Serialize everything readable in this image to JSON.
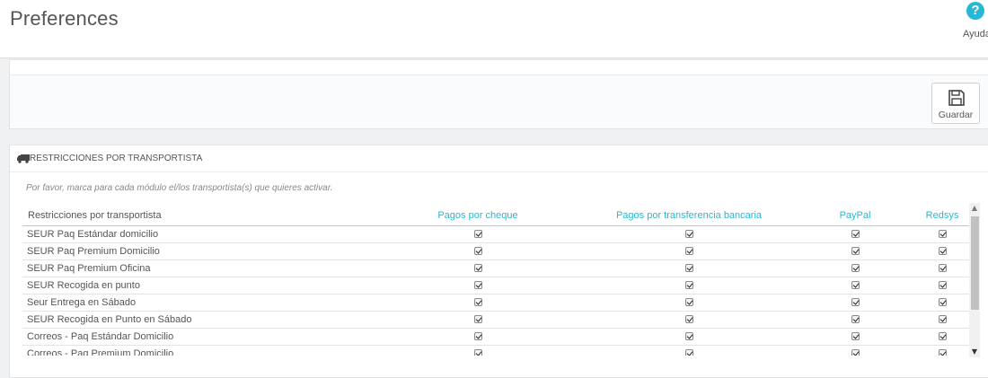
{
  "header": {
    "title": "Preferences",
    "help_icon": "?",
    "help_label": "Ayuda"
  },
  "toolbar": {
    "save_label": "Guardar",
    "save_icon": "floppy-disk-icon"
  },
  "panel": {
    "icon": "truck-icon",
    "heading": "Restricciones por transportista",
    "help_text": "Por favor, marca para cada módulo el/los transportista(s) que quieres activar."
  },
  "table": {
    "columns": [
      "Restricciones por transportista",
      "Pagos por cheque",
      "Pagos por transferencia bancaria",
      "PayPal",
      "Redsys"
    ],
    "rows": [
      {
        "carrier": "SEUR Paq Estándar domicilio",
        "checks": [
          true,
          true,
          true,
          true
        ]
      },
      {
        "carrier": "SEUR Paq Premium Domicilio",
        "checks": [
          true,
          true,
          true,
          true
        ]
      },
      {
        "carrier": "SEUR Paq Premium Oficina",
        "checks": [
          true,
          true,
          true,
          true
        ]
      },
      {
        "carrier": "SEUR Recogida en punto",
        "checks": [
          true,
          true,
          true,
          true
        ]
      },
      {
        "carrier": "Seur Entrega en Sábado",
        "checks": [
          true,
          true,
          true,
          true
        ]
      },
      {
        "carrier": "SEUR Recogida en Punto en Sábado",
        "checks": [
          true,
          true,
          true,
          true
        ]
      },
      {
        "carrier": "Correos - Paq Estándar Domicilio",
        "checks": [
          true,
          true,
          true,
          true
        ]
      },
      {
        "carrier": "Correos - Paq Premium Domicilio",
        "checks": [
          true,
          true,
          true,
          true
        ]
      }
    ]
  },
  "colors": {
    "accent": "#25b9d7",
    "text": "#555555",
    "background": "#eff1f2"
  }
}
